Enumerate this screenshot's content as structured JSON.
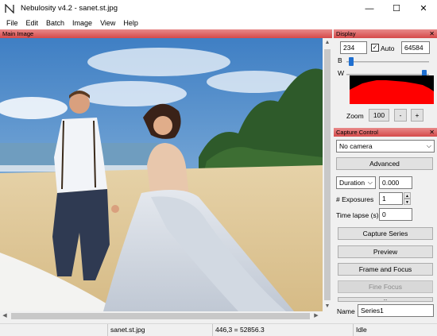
{
  "window": {
    "title": "Nebulosity v4.2 - sanet.st.jpg",
    "minimize": "—",
    "maximize": "☐",
    "close": "✕"
  },
  "menu": [
    "File",
    "Edit",
    "Batch",
    "Image",
    "View",
    "Help"
  ],
  "main_panel": {
    "title": "Main Image",
    "image_description": "photo"
  },
  "display": {
    "title": "Display",
    "close": "✕",
    "black_value": "234",
    "white_value": "64584",
    "auto_label": "Auto",
    "auto_checked": true,
    "auto_mark": "✓",
    "b_label": "B",
    "w_label": "W",
    "b_level": 0.03,
    "w_level": 0.97,
    "zoom_label": "Zoom",
    "zoom_value": "100",
    "zoom_minus": "-",
    "zoom_plus": "+"
  },
  "capture": {
    "title": "Capture Control",
    "close": "✕",
    "camera": "No camera",
    "advanced": "Advanced",
    "duration_label": "Duration",
    "duration_value": "0.000",
    "exposures_label": "# Exposures",
    "exposures_value": "1",
    "timelapse_label": "Time lapse (s)",
    "timelapse_value": "0",
    "capture_series": "Capture Series",
    "preview": "Preview",
    "frame_focus": "Frame and Focus",
    "fine_focus": "Fine Focus",
    "partial_button": "...",
    "name_label": "Name",
    "name_value": "Series1"
  },
  "status": {
    "filename": "sanet.st.jpg",
    "coords": "446,3 = 52856.3",
    "state": "Idle"
  },
  "colors": {
    "panel_header": "#d54a4a",
    "histogram_fill": "#ff0000",
    "slider_thumb": "#1f6fd0"
  }
}
